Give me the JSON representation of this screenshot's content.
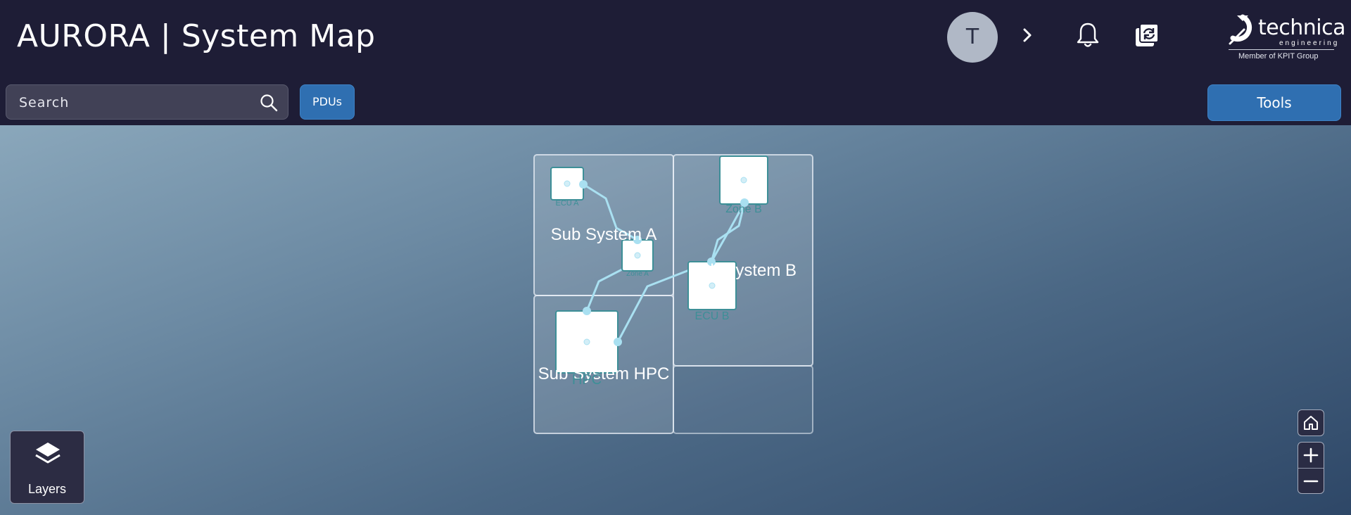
{
  "header": {
    "title": "AURORA | System Map",
    "avatar_initial": "T",
    "icons": [
      "chevron-right-icon",
      "bell-icon",
      "sync-icon"
    ],
    "logo": {
      "word": "technica",
      "sub": "engineering",
      "member": "Member of KPIT Group"
    }
  },
  "toolbar": {
    "search_placeholder": "Search",
    "pdus_label": "PDUs",
    "tools_label": "Tools"
  },
  "map": {
    "subsystems": [
      "Sub System A",
      "Sub System B",
      "Sub System HPC"
    ],
    "nodes": [
      "ECU A",
      "Zone A",
      "Zone B",
      "ECU B",
      "HPC"
    ]
  },
  "controls": {
    "layers_label": "Layers",
    "zoom": [
      "home",
      "zoom-in",
      "zoom-out"
    ]
  },
  "colors": {
    "header_bg": "#1e1d36",
    "accent_button": "#2f6fb1",
    "node_border": "#3d8f97",
    "link": "#a9e0f1"
  }
}
